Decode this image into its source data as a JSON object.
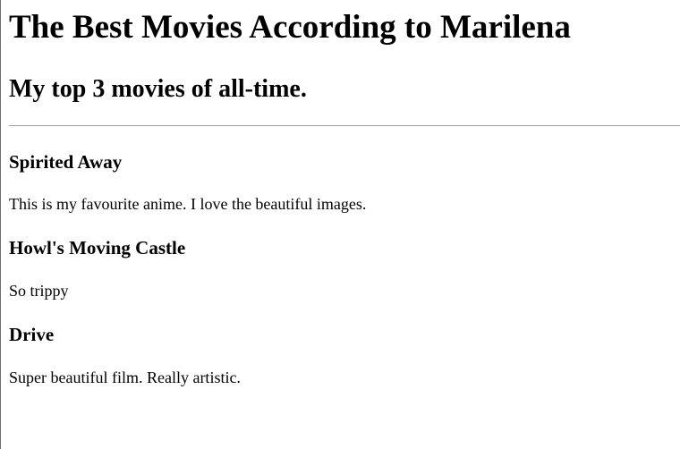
{
  "header": {
    "title": "The Best Movies According to Marilena",
    "subtitle": "My top 3 movies of all-time."
  },
  "movies": [
    {
      "title": "Spirited Away",
      "description": "This is my favourite anime. I love the beautiful images."
    },
    {
      "title": "Howl's Moving Castle",
      "description": "So trippy"
    },
    {
      "title": "Drive",
      "description": "Super beautiful film. Really artistic."
    }
  ]
}
